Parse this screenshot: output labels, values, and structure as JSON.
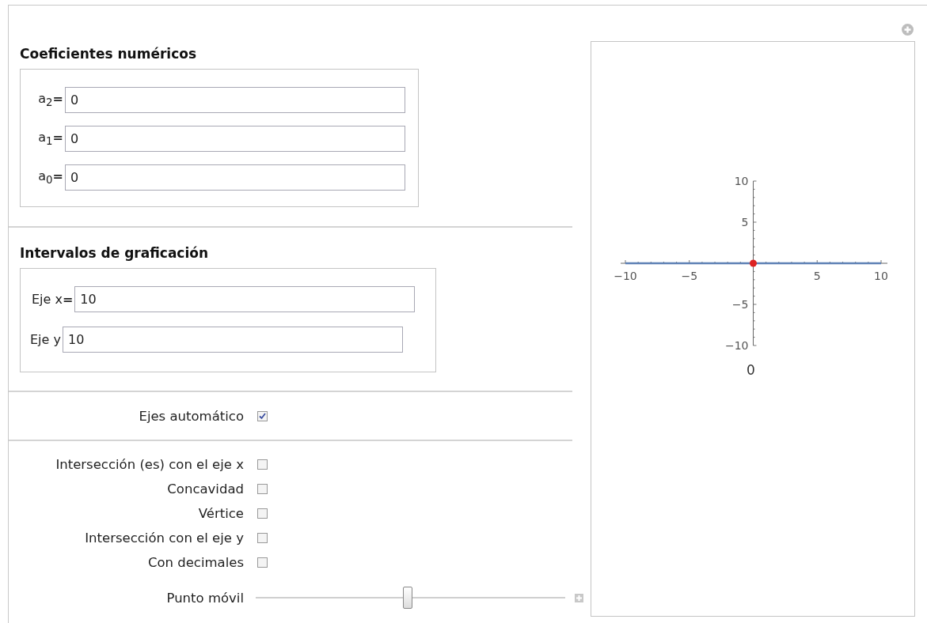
{
  "coefficients": {
    "title": "Coeficientes numéricos",
    "fields": [
      {
        "label": "a$_{2}$**=**",
        "value": "0"
      },
      {
        "label": "a$_{1}$**=**",
        "value": "0"
      },
      {
        "label": "a$_{0}$**=**",
        "value": "0"
      }
    ]
  },
  "intervals": {
    "title": "Intervalos de graficación",
    "fields": [
      {
        "label": "Eje x**=**",
        "value": "10"
      },
      {
        "label": "Eje y",
        "value": "10"
      }
    ]
  },
  "auto_axes": {
    "label": "Ejes automático",
    "checked": true
  },
  "options": [
    {
      "label": "Intersección (es) con el eje x",
      "checked": false
    },
    {
      "label": "Concavidad",
      "checked": false
    },
    {
      "label": "Vértice",
      "checked": false
    },
    {
      "label": "Intersección con el eje y",
      "checked": false
    },
    {
      "label": "Con decimales",
      "checked": false
    }
  ],
  "moving_point": {
    "label": "Punto móvil",
    "level": 0.49
  },
  "plot": {
    "caption": "0",
    "chart_data": {
      "type": "line",
      "x": [
        -10,
        10
      ],
      "series": [
        {
          "color": "#5e81b5",
          "values": [
            0,
            0
          ]
        }
      ],
      "xlim": [
        -10,
        10
      ],
      "ylim": [
        -10,
        10
      ],
      "xticks": [
        {
          "value": -10,
          "label": "−10"
        },
        {
          "value": -5,
          "label": "−5"
        },
        5,
        10
      ],
      "yticks": [
        {
          "value": -10,
          "label": "−10"
        },
        {
          "value": -5,
          "label": "−5"
        },
        5,
        10
      ]
    }
  }
}
